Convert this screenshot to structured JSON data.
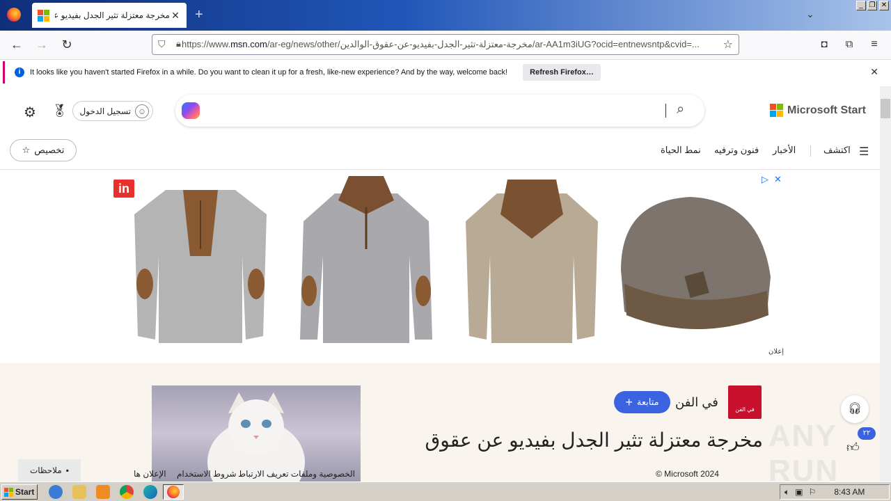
{
  "window": {
    "tab_title": "مخرجة معتزلة تثير الجدل بفيديو عن",
    "new_tab_label": "+",
    "min": "_",
    "restore": "❐",
    "close": "✕"
  },
  "nav": {
    "url_prefix": "https://www.",
    "url_host": "msn.com",
    "url_rest": "/ar-eg/news/other/مخرجة-معتزلة-تثير-الجدل-بفيديو-عن-عقوق-الوالدين/ar-AA1m3iUG?ocid=entnewsntp&cvid=..."
  },
  "notification": {
    "icon": "i",
    "text": "It looks like you haven't started Firefox in a while. Do you want to clean it up for a fresh, like-new experience? And by the way, welcome back!",
    "button": "Refresh Firefox…",
    "close": "✕"
  },
  "header": {
    "brand": "Microsoft Start",
    "signin": "تسجيل الدخول",
    "customize": "تخصيص",
    "categories": [
      "اكتشف",
      "الأخبار",
      "فنون وترفيه",
      "نمط الحياة"
    ]
  },
  "ad": {
    "label": "إعلان",
    "badge": "in",
    "close": "✕"
  },
  "article": {
    "source": "في الفن",
    "source_logo_text": "في الفن",
    "follow": "متابعة",
    "headline": "مخرجة معتزلة تثير الجدل بفيديو عن عقوق",
    "like_count": "٢٢"
  },
  "footer": {
    "feedback": "ملاحظات",
    "copyright": "© Microsoft 2024",
    "links": [
      "الخصوصية وملفات تعريف الارتباط",
      "شروط الاستخدام",
      "الإعلان ها"
    ]
  },
  "taskbar": {
    "start": "Start",
    "clock": "8:43 AM"
  },
  "watermark": "ANY RUN",
  "colors": {
    "accent": "#3b63e0",
    "notif_border": "#d1006c",
    "ms_red": "#f25022",
    "ms_green": "#7fba00",
    "ms_blue": "#00a4ef",
    "ms_yellow": "#ffb900"
  }
}
